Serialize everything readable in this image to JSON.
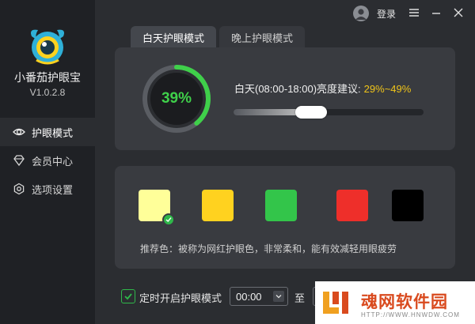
{
  "app": {
    "name": "小番茄护眼宝",
    "version": "V1.0.2.8"
  },
  "sidebar": {
    "items": [
      {
        "label": "护眼模式",
        "icon": "eye-icon",
        "active": true
      },
      {
        "label": "会员中心",
        "icon": "diamond-icon",
        "active": false
      },
      {
        "label": "选项设置",
        "icon": "settings-icon",
        "active": false
      }
    ]
  },
  "topbar": {
    "login_label": "登录",
    "icons": [
      "user-icon",
      "settings-icon",
      "minimize-icon",
      "close-icon"
    ]
  },
  "tabs": [
    {
      "label": "白天护眼模式",
      "active": true
    },
    {
      "label": "晚上护眼模式",
      "active": false
    }
  ],
  "brightness": {
    "percent_label": "39%",
    "percent": 39,
    "period_label": "白天(08:00-18:00)亮度建议:",
    "suggested_range": "29%~49%",
    "slider_value": 0.39
  },
  "colors": {
    "swatches": [
      {
        "name": "light-yellow",
        "hex": "#ffff99",
        "selected": true
      },
      {
        "name": "yellow",
        "hex": "#ffd21f",
        "selected": false
      },
      {
        "name": "green",
        "hex": "#33c54a",
        "selected": false
      },
      {
        "name": "red",
        "hex": "#ee2f2a",
        "selected": false
      },
      {
        "name": "black",
        "hex": "#000000",
        "selected": false
      }
    ],
    "recommend_text": "推荐色：被称为网红护眼色，非常柔和，能有效减轻用眼疲劳"
  },
  "timer": {
    "checked": true,
    "label": "定时开启护眼模式",
    "start_time": "00:00",
    "to_label": "至"
  },
  "watermark": {
    "title": "魂网软件园",
    "url": "HTTP://WWW.HNWDW.COM"
  },
  "theme": {
    "accent_green": "#3fd04a",
    "accent_yellow": "#f0c419"
  }
}
